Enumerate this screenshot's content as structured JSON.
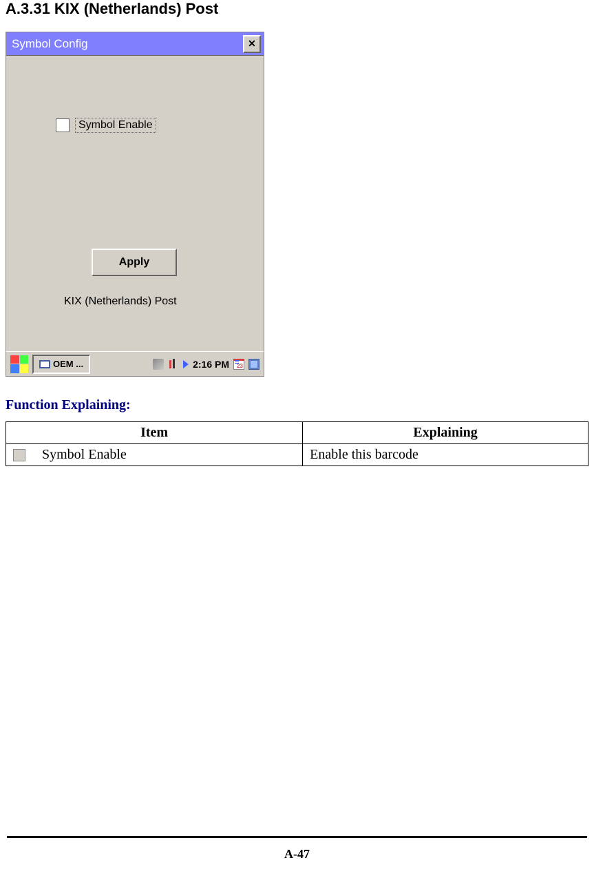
{
  "heading": "A.3.31 KIX (Netherlands) Post",
  "dialog": {
    "title": "Symbol Config",
    "checkbox_label": "Symbol Enable",
    "apply_label": "Apply",
    "subtitle": "KIX (Netherlands) Post"
  },
  "taskbar": {
    "task_label": "OEM ...",
    "time": "2:16 PM",
    "cal_day": "23"
  },
  "function_heading": "Function Explaining:",
  "table": {
    "header_item": "Item",
    "header_explaining": "Explaining",
    "rows": [
      {
        "item": "Symbol Enable",
        "explaining": "Enable this barcode"
      }
    ]
  },
  "page_number": "A-47"
}
